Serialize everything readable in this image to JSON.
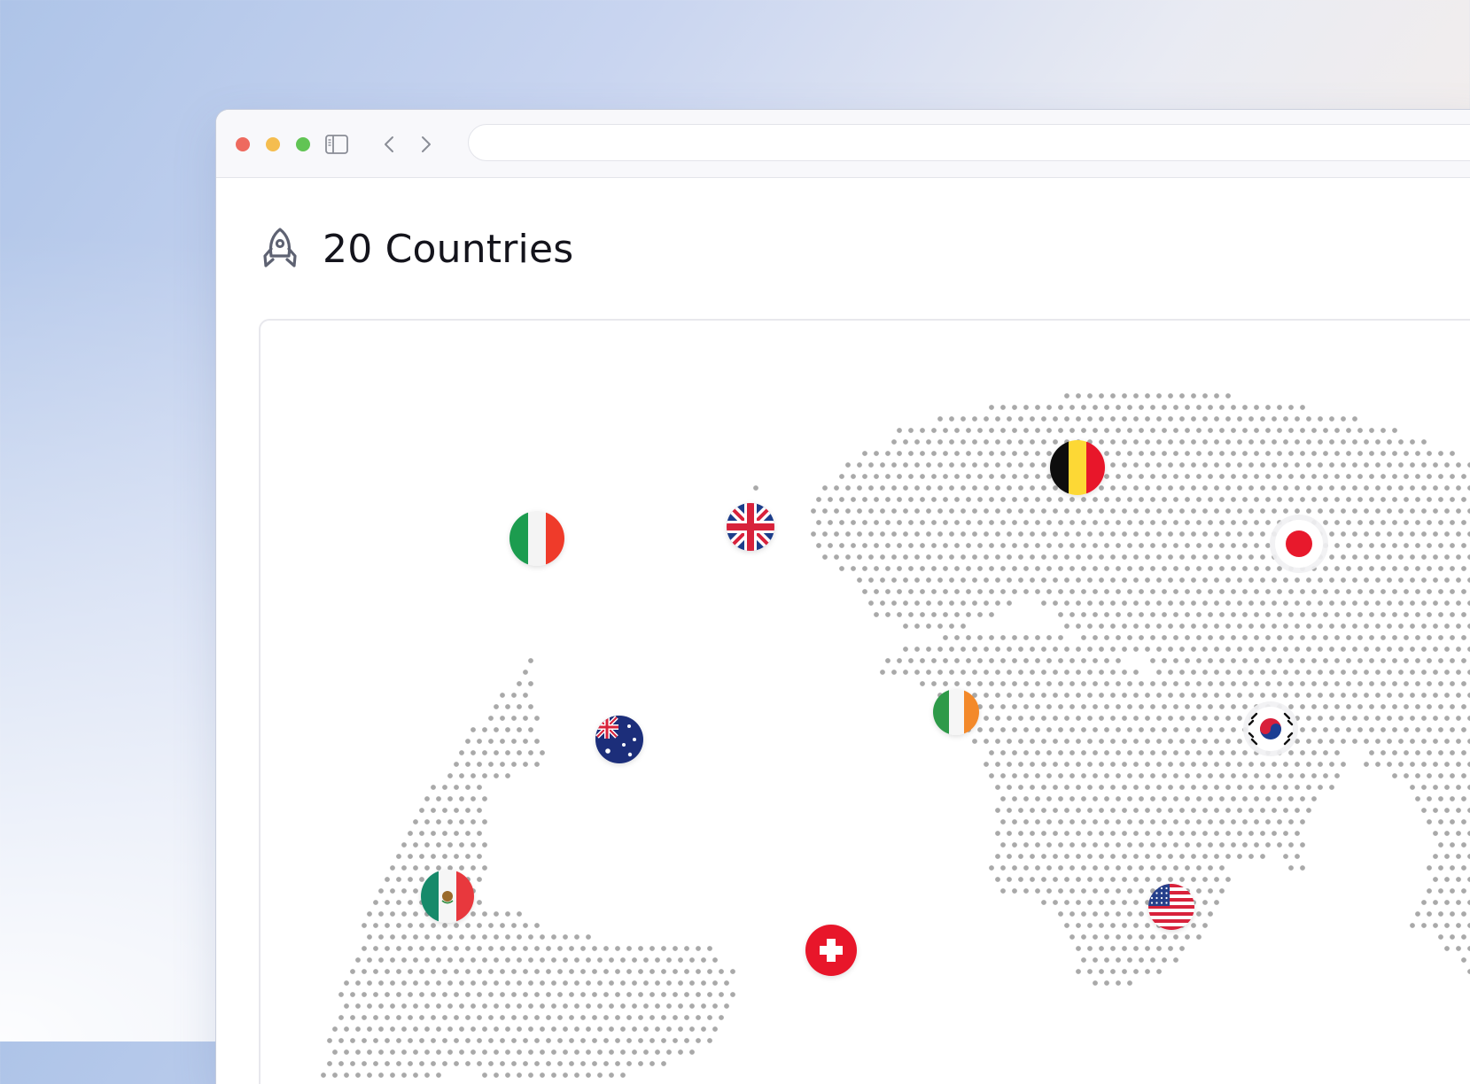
{
  "background": {
    "gradient_colors": [
      "#aec4e8",
      "#e9ebf3",
      "#fbefe6"
    ]
  },
  "window": {
    "traffic_lights": [
      "#ee6a5f",
      "#f5bd4f",
      "#61c454"
    ],
    "toolbar_icons": [
      "sidebar-toggle-icon",
      "chevron-left-icon",
      "chevron-right-icon"
    ],
    "address_bar": {
      "value": ""
    }
  },
  "page": {
    "icon": "rocket-icon",
    "title": "20 Countries"
  },
  "map": {
    "dot_color": "#a9a9a9",
    "flags": [
      {
        "country": "italy",
        "icon": "flag-italy-icon"
      },
      {
        "country": "united-kingdom",
        "icon": "flag-united-kingdom-icon"
      },
      {
        "country": "belgium",
        "icon": "flag-belgium-icon"
      },
      {
        "country": "japan",
        "icon": "flag-japan-icon"
      },
      {
        "country": "australia",
        "icon": "flag-australia-icon"
      },
      {
        "country": "ireland",
        "icon": "flag-ireland-icon"
      },
      {
        "country": "south-korea",
        "icon": "flag-south-korea-icon"
      },
      {
        "country": "mexico",
        "icon": "flag-mexico-icon"
      },
      {
        "country": "switzerland",
        "icon": "flag-switzerland-icon"
      },
      {
        "country": "united-states",
        "icon": "flag-united-states-icon"
      }
    ]
  }
}
